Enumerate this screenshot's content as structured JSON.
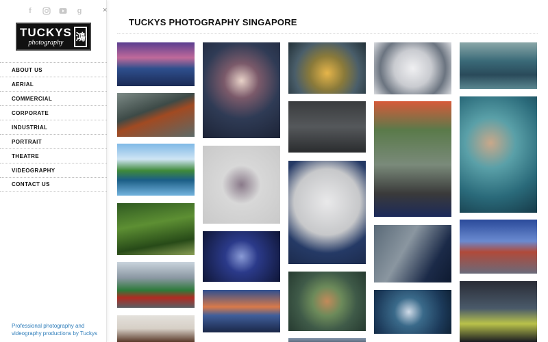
{
  "sidebar": {
    "socials": [
      {
        "icon": "facebook-icon",
        "glyph": "f"
      },
      {
        "icon": "instagram-icon",
        "glyph": ""
      },
      {
        "icon": "youtube-icon",
        "glyph": ""
      },
      {
        "icon": "googleplus-icon",
        "glyph": "g"
      }
    ],
    "close_glyph": "×",
    "logo": {
      "main": "TUCKYS",
      "sub": "photography",
      "mark": "鴻"
    },
    "nav": [
      {
        "label": "ABOUT US"
      },
      {
        "label": "AERIAL"
      },
      {
        "label": "COMMERCIAL"
      },
      {
        "label": "CORPORATE"
      },
      {
        "label": "INDUSTRIAL"
      },
      {
        "label": "PORTRAIT"
      },
      {
        "label": "THEATRE"
      },
      {
        "label": "VIDEOGRAPHY"
      },
      {
        "label": "CONTACT US"
      }
    ],
    "tagline": "Professional photography and videography productions by Tuckys"
  },
  "main": {
    "title": "TUCKYS PHOTOGRAPHY SINGAPORE"
  },
  "gallery": [
    {
      "name": "city-skyline-dusk",
      "bg": "linear-gradient(180deg,#5a3e8f 0%,#c06a9a 35%,#2e4f8d 60%,#1b2a55 100%)"
    },
    {
      "name": "aerial-construction-site",
      "bg": "linear-gradient(160deg,#7c8a86 0%,#3d4a47 40%,#a14a22 55%,#5c6a68 100%)"
    },
    {
      "name": "condo-reflection",
      "bg": "linear-gradient(180deg,#7fb9e6 0%,#cfe4f4 30%,#3f8a3a 52%,#1b5e86 70%,#73b3de 100%)"
    },
    {
      "name": "forest-path",
      "bg": "linear-gradient(170deg,#2f5a22 0%,#5d8f33 40%,#274a18 75%,#8a9f55 100%)"
    },
    {
      "name": "ship-in-drydock",
      "bg": "linear-gradient(180deg,#c9d3dc 0%,#8a97a2 35%,#2d7a3a 62%,#b02b22 78%,#5a5f63 100%)"
    },
    {
      "name": "woman-portrait-partial",
      "bg": "linear-gradient(180deg,#e4e1dc 0%,#d6cfc6 50%,#5a3a2a 100%)"
    },
    {
      "name": "dancers-group",
      "bg": "radial-gradient(circle at 50% 40%,#e8d2c8 0%,#7b5a6a 25%,#2f3b55 55%,#1c2336 100%)"
    },
    {
      "name": "theatre-cast-white",
      "bg": "radial-gradient(circle at 50% 50%,#8a7a8a 0%,#d8d8d8 35%,#c9c9c9 100%)"
    },
    {
      "name": "theatre-stage-blue",
      "bg": "radial-gradient(circle at 50% 50%,#8a9bd6 0%,#2b3a8a 35%,#0f1636 100%)"
    },
    {
      "name": "marina-bay-dusk",
      "bg": "linear-gradient(180deg,#2f4f8f 0%,#d97a4a 40%,#405e9a 60%,#1a2748 100%)"
    },
    {
      "name": "futuristic-dome",
      "bg": "radial-gradient(circle at 50% 60%,#e6b54a 0%,#8a7a3a 35%,#4a5e6a 65%,#223038 100%)"
    },
    {
      "name": "corporate-group",
      "bg": "linear-gradient(180deg,#3a3c3e 0%,#55585b 50%,#2a2c2e 100%)"
    },
    {
      "name": "businessman-portrait",
      "bg": "radial-gradient(circle at 50% 40%,#e9e9ea 0%,#c7c8ca 45%,#253a66 70%,#1c2b4d 100%)"
    },
    {
      "name": "underwater-dancer",
      "bg": "radial-gradient(circle at 50% 50%,#c28a5a 0%,#6c8a5a 30%,#3f5a48 60%,#263a30 100%)"
    },
    {
      "name": "bottom-partial-1",
      "bg": "linear-gradient(180deg,#8a9bb0 0%,#5c6d80 100%)"
    },
    {
      "name": "jet-engine",
      "bg": "radial-gradient(circle at 50% 50%,#f0f0f2 0%,#c9cbd0 40%,#6b7480 70%,#d8dade 100%)"
    },
    {
      "name": "fitness-outdoor",
      "bg": "linear-gradient(180deg,#d65a3a 0%,#5a7a4a 25%,#7a8a7a 55%,#3a3a3a 80%,#1c2a5a 100%)"
    },
    {
      "name": "technician-lab",
      "bg": "linear-gradient(120deg,#5a6a78 0%,#8a96a0 40%,#1b2a48 75%,#0e1a30 100%)"
    },
    {
      "name": "aerial-swirl",
      "bg": "radial-gradient(circle at 45% 50%,#d0dbe8 0%,#3a6a8a 30%,#1c3a5a 70%,#0f2236 100%)"
    },
    {
      "name": "speedboat",
      "bg": "linear-gradient(180deg,#8aa7a8 0%,#3a6a78 40%,#2a4a5a 70%,#5a8790 100%)"
    },
    {
      "name": "underwater-woman",
      "bg": "radial-gradient(circle at 40% 40%,#c9a88a 0%,#5aa0a8 30%,#2a6a7a 65%,#163a48 100%)"
    },
    {
      "name": "woman-sky-dusk",
      "bg": "linear-gradient(180deg,#2a4a9a 0%,#6a8ad0 40%,#b04a3a 60%,#6a6a7a 100%)"
    },
    {
      "name": "workers-night",
      "bg": "linear-gradient(180deg,#2a2c36 0%,#4a5a6a 45%,#b9c24a 70%,#1a1c22 100%)"
    }
  ]
}
